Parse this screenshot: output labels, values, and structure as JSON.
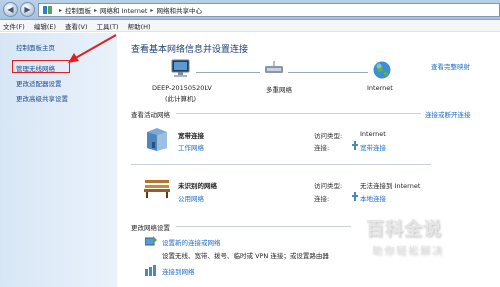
{
  "address_bar": {
    "crumbs": [
      "控制面板",
      "网络和 Internet",
      "网络和共享中心"
    ]
  },
  "menu": [
    "文件(F)",
    "编辑(E)",
    "查看(V)",
    "工具(T)",
    "帮助(H)"
  ],
  "left_pane": {
    "items": [
      "控制面板主页",
      "管理无线网络",
      "更改适配器设置",
      "更改高级共享设置"
    ],
    "highlighted_item": "管理无线网络",
    "highlight_color": "#e02020"
  },
  "main": {
    "heading": "查看基本网络信息并设置连接",
    "full_map_link": "查看完整映射",
    "network_map": {
      "computer_name": "DEEP-20150520LV",
      "computer_note": "(此计算机)",
      "middle_label": "多重网络",
      "internet_label": "Internet"
    },
    "active_networks_title": "查看活动网络",
    "connect_disconnect_link": "连接或断开连接",
    "networks": [
      {
        "name": "宽带连接",
        "type": "工作网络",
        "access_label": "访问类型:",
        "access_value": "Internet",
        "connection_label": "连接:",
        "connection_value": "宽带连接"
      },
      {
        "name": "未识别的网络",
        "type": "公用网络",
        "access_label": "访问类型:",
        "access_value": "无法连接到 Internet",
        "connection_label": "连接:",
        "connection_value": "本地连接"
      }
    ],
    "change_settings_title": "更改网络设置",
    "settings": [
      {
        "link": "设置新的连接或网络",
        "description": "设置无线、宽带、拨号、临时或 VPN 连接；或设置路由器"
      },
      {
        "link": "连接到网络",
        "description": ""
      }
    ]
  },
  "watermark": {
    "title": "百科全说",
    "subtitle": "助你轻松解决"
  },
  "colors": {
    "link": "#1c6bc4",
    "heading": "#1c3f7a",
    "left_pane_bg": "#dbe8f7",
    "titlebar_bg": "#b9d1ea"
  }
}
